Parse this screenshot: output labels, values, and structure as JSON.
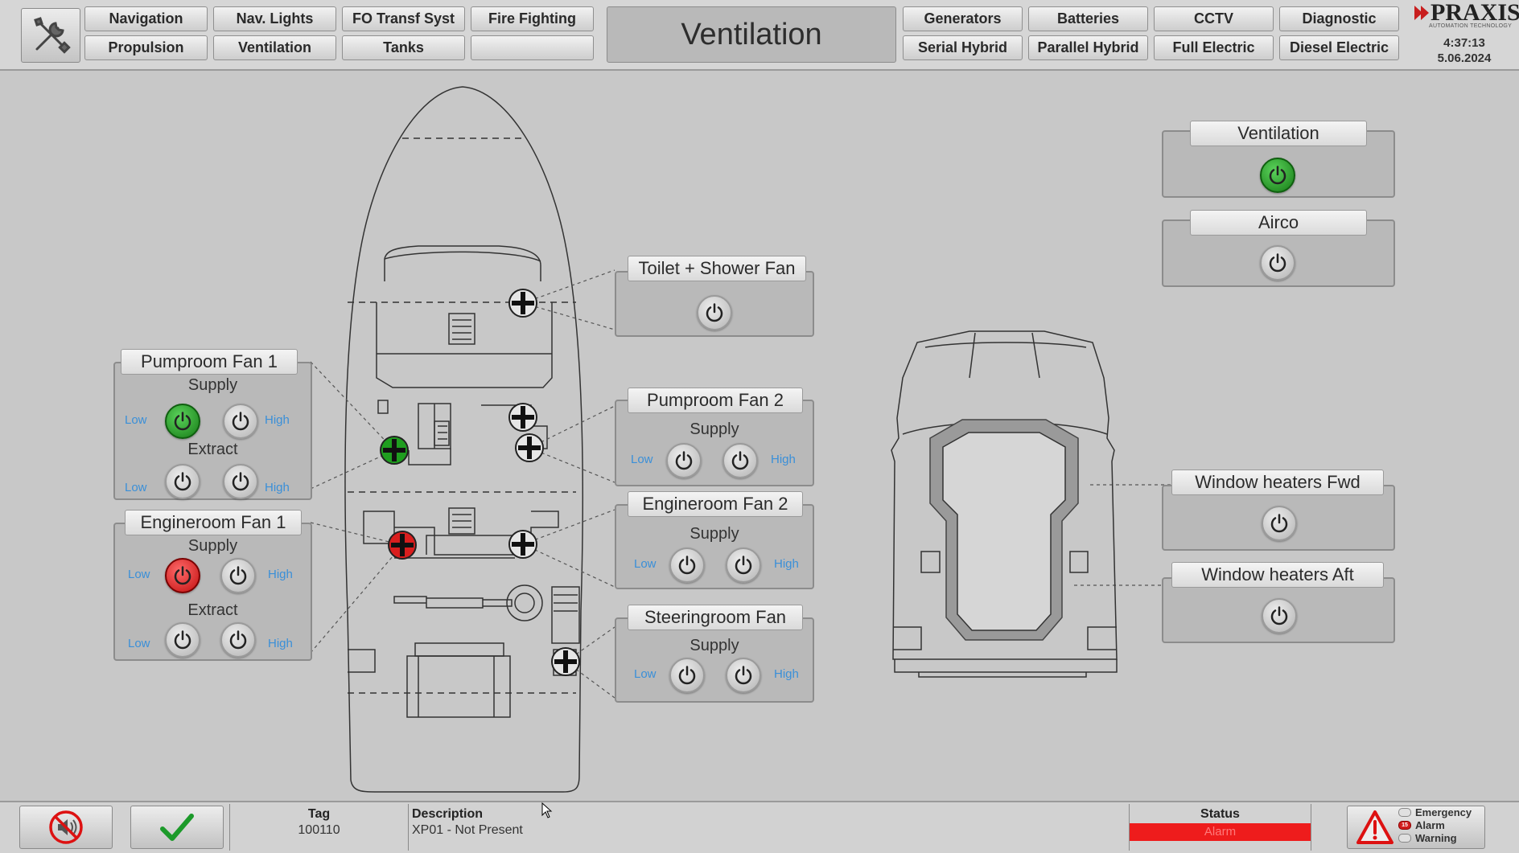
{
  "header": {
    "nav_row1": [
      "Navigation",
      "Nav. Lights",
      "FO Transf Syst",
      "Fire Fighting"
    ],
    "nav_row2": [
      "Propulsion",
      "Ventilation",
      "Tanks",
      ""
    ],
    "page_title": "Ventilation",
    "sys_row1": [
      "Generators",
      "Batteries",
      "CCTV",
      "Diagnostic"
    ],
    "sys_row2": [
      "Serial Hybrid",
      "Parallel Hybrid",
      "Full Electric",
      "Diesel Electric"
    ],
    "logo_text": "PRAXIS",
    "logo_subtext": "AUTOMATION TECHNOLOGY",
    "time": "4:37:13",
    "date": "5.06.2024"
  },
  "panels": {
    "pumproom_fan_1": {
      "title": "Pumproom Fan 1",
      "supply_label": "Supply",
      "extract_label": "Extract",
      "low": "Low",
      "high": "High"
    },
    "engineroom_fan_1": {
      "title": "Engineroom Fan 1",
      "supply_label": "Supply",
      "extract_label": "Extract",
      "low": "Low",
      "high": "High"
    },
    "toilet_shower_fan": {
      "title": "Toilet + Shower Fan"
    },
    "pumproom_fan_2": {
      "title": "Pumproom Fan 2",
      "supply_label": "Supply",
      "low": "Low",
      "high": "High"
    },
    "engineroom_fan_2": {
      "title": "Engineroom Fan 2",
      "supply_label": "Supply",
      "low": "Low",
      "high": "High"
    },
    "steeringroom_fan": {
      "title": "Steeringroom Fan",
      "supply_label": "Supply",
      "low": "Low",
      "high": "High"
    },
    "ventilation": {
      "title": "Ventilation"
    },
    "airco": {
      "title": "Airco"
    },
    "window_heaters_fwd": {
      "title": "Window heaters Fwd"
    },
    "window_heaters_aft": {
      "title": "Window heaters Aft"
    }
  },
  "states": {
    "pumproom_fan_1_supply_low": "on",
    "engineroom_fan_1_supply_low": "alarm",
    "ventilation_main": "on"
  },
  "statusbar": {
    "tag_header": "Tag",
    "tag_value": "100110",
    "description_header": "Description",
    "description_value": "XP01 - Not Present",
    "status_header": "Status",
    "status_value": "Alarm",
    "legend": [
      "Emergency",
      "Alarm",
      "Warning"
    ],
    "alarm_count": "15"
  },
  "colors": {
    "on": "#1d9a1d",
    "alarm": "#d21d1d",
    "speed_label": "#3a8fd8",
    "status_alarm_bg": "#ee1c1c"
  },
  "icons": [
    "tools-icon",
    "power-icon",
    "fan-icon",
    "mute-icon",
    "checkmark-icon",
    "warning-triangle-icon"
  ]
}
